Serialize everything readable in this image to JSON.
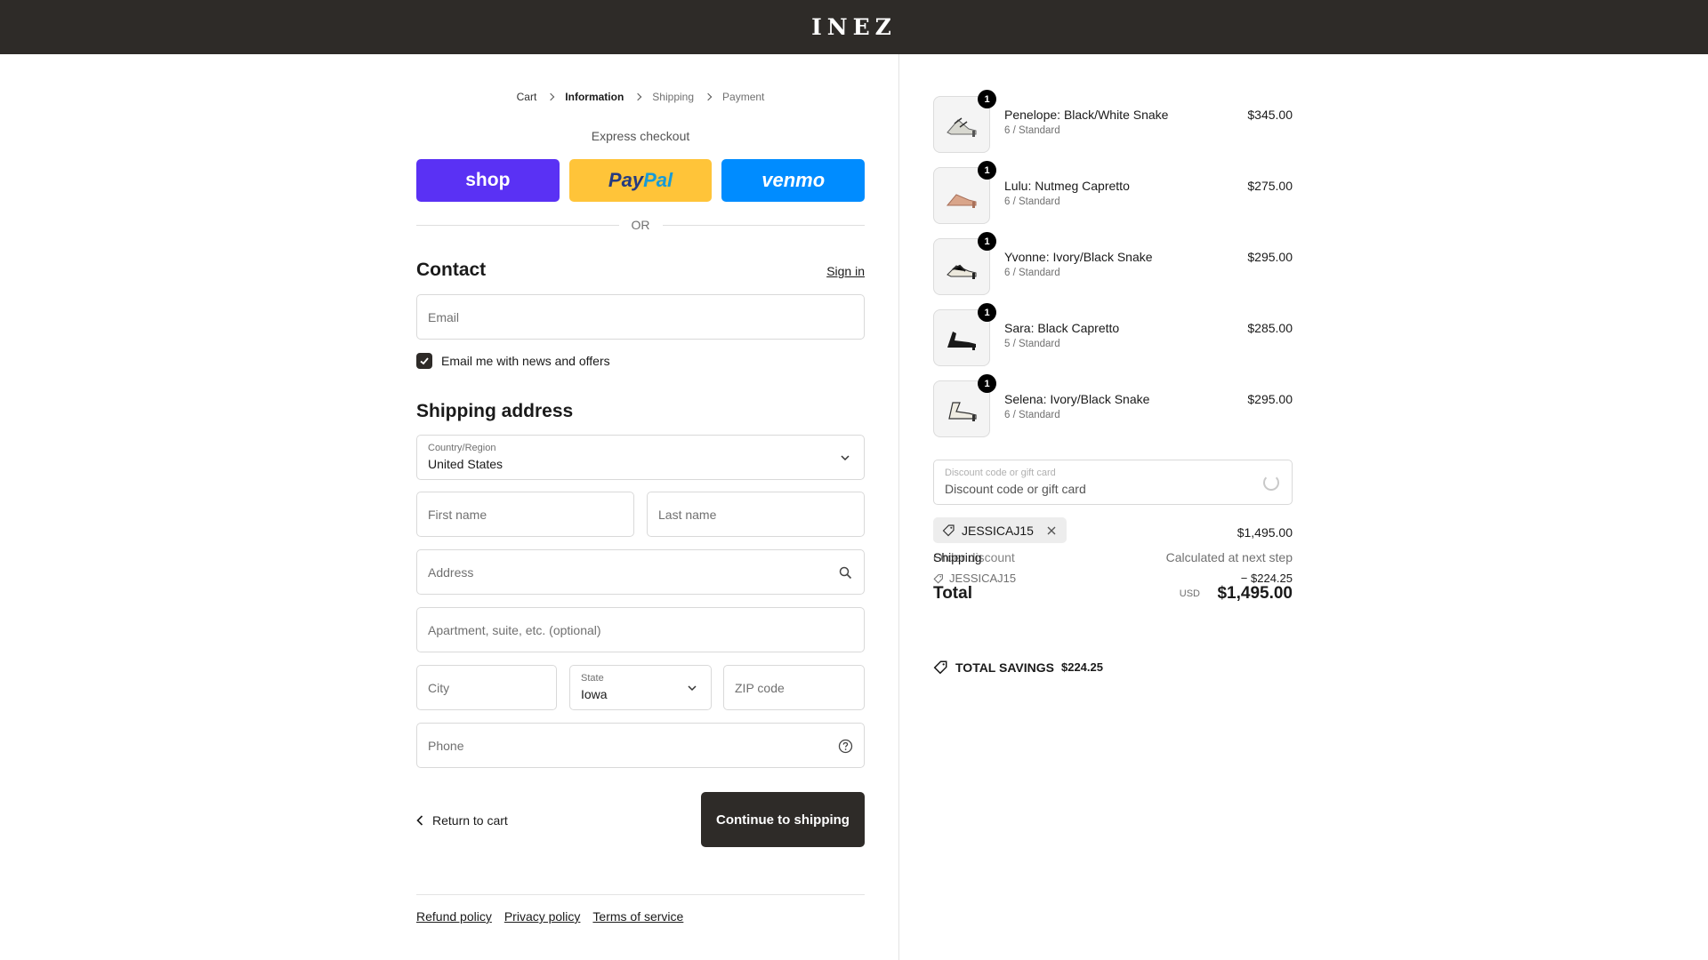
{
  "brand": {
    "logo_text": "INEZ"
  },
  "breadcrumb": {
    "items": [
      {
        "label": "Cart"
      },
      {
        "label": "Information"
      },
      {
        "label": "Shipping"
      },
      {
        "label": "Payment"
      }
    ]
  },
  "express": {
    "title": "Express checkout",
    "shop_label": "shop",
    "paypal_label_1": "Pay",
    "paypal_label_2": "Pal",
    "venmo_label": "venmo",
    "or_label": "OR"
  },
  "contact": {
    "title": "Contact",
    "signin_label": "Sign in",
    "email_placeholder": "Email",
    "newsletter_label": "Email me with news and offers",
    "newsletter_checked": true
  },
  "shipping": {
    "title": "Shipping address",
    "country_label": "Country/Region",
    "country_value": "United States",
    "first_name_placeholder": "First name",
    "last_name_placeholder": "Last name",
    "address_placeholder": "Address",
    "apartment_placeholder": "Apartment, suite, etc. (optional)",
    "city_placeholder": "City",
    "state_label": "State",
    "state_value": "Iowa",
    "zip_placeholder": "ZIP code",
    "phone_placeholder": "Phone"
  },
  "actions": {
    "return_label": "Return to cart",
    "continue_label": "Continue to shipping"
  },
  "footer": {
    "links": [
      "Refund policy",
      "Privacy policy",
      "Terms of service"
    ]
  },
  "order": {
    "items": [
      {
        "name": "Penelope: Black/White Snake",
        "variant": "6 / Standard",
        "price": "$345.00",
        "qty": "1"
      },
      {
        "name": "Lulu: Nutmeg Capretto",
        "variant": "6 / Standard",
        "price": "$275.00",
        "qty": "1"
      },
      {
        "name": "Yvonne: Ivory/Black Snake",
        "variant": "6 / Standard",
        "price": "$295.00",
        "qty": "1"
      },
      {
        "name": "Sara: Black Capretto",
        "variant": "5 / Standard",
        "price": "$285.00",
        "qty": "1"
      },
      {
        "name": "Selena: Ivory/Black Snake",
        "variant": "6 / Standard",
        "price": "$295.00",
        "qty": "1"
      }
    ],
    "discount_label": "Discount code or gift card",
    "discount_placeholder": "Discount code or gift card",
    "applied_code": "JESSICAJ15",
    "subtotal_value": "$1,495.00",
    "shipping_label": "Shipping",
    "shipping_value": "Calculated at next step",
    "discount_row_label": "Order discount",
    "discount_code_sub": "JESSICAJ15",
    "discount_value": "− $224.25",
    "total_label": "Total",
    "currency": "USD",
    "total_value": "$1,495.00",
    "savings_label": "TOTAL SAVINGS",
    "savings_value": "$224.25"
  }
}
